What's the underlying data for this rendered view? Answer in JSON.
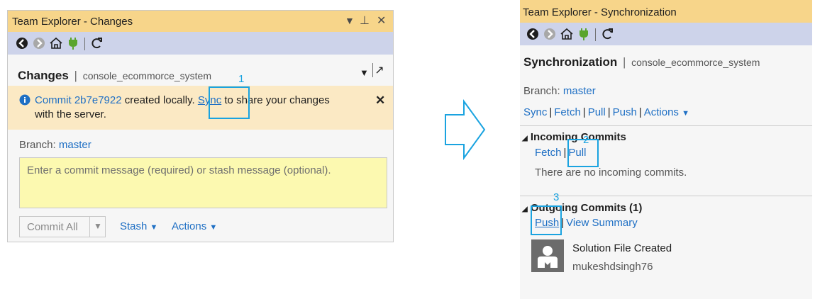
{
  "left_panel": {
    "title": "Team Explorer - Changes",
    "window_icons": [
      "▾",
      "ᵰ",
      "✕"
    ],
    "header_title": "Changes",
    "header_repo": "console_ecommorce_system",
    "info": {
      "commit_link": "Commit 2b7e7922",
      "text_a": " created locally. ",
      "sync_link": "Sync",
      "text_b": " to share your changes",
      "text_c": "with the server."
    },
    "branch_label": "Branch:",
    "branch_value": "master",
    "commit_placeholder": "Enter a commit message (required) or stash message (optional).",
    "commit_all_label": "Commit All",
    "stash_label": "Stash",
    "actions_label": "Actions",
    "highlight_number": "1"
  },
  "right_panel": {
    "title": "Team Explorer - Synchronization",
    "header_title": "Synchronization",
    "header_repo": "console_ecommorce_system",
    "branch_label": "Branch:",
    "branch_value": "master",
    "action_links": [
      "Sync",
      "Fetch",
      "Pull",
      "Push",
      "Actions"
    ],
    "incoming": {
      "heading": "Incoming Commits",
      "fetch": "Fetch",
      "pull": "Pull",
      "empty_text": "There are no incoming commits.",
      "highlight_number": "2"
    },
    "outgoing": {
      "heading": "Outgoing Commits (1)",
      "push": "Push",
      "view_summary": "View Summary",
      "highlight_number": "3",
      "commit_title": "Solution File Created",
      "commit_author": "mukeshdsingh76"
    }
  },
  "colors": {
    "title_bar": "#f7d58a",
    "toolbar": "#cdd3ea",
    "info_bar": "#fbe9c4",
    "link": "#1e6fc4",
    "highlight": "#1aa3e0",
    "commit_box": "#fcf9b0"
  }
}
